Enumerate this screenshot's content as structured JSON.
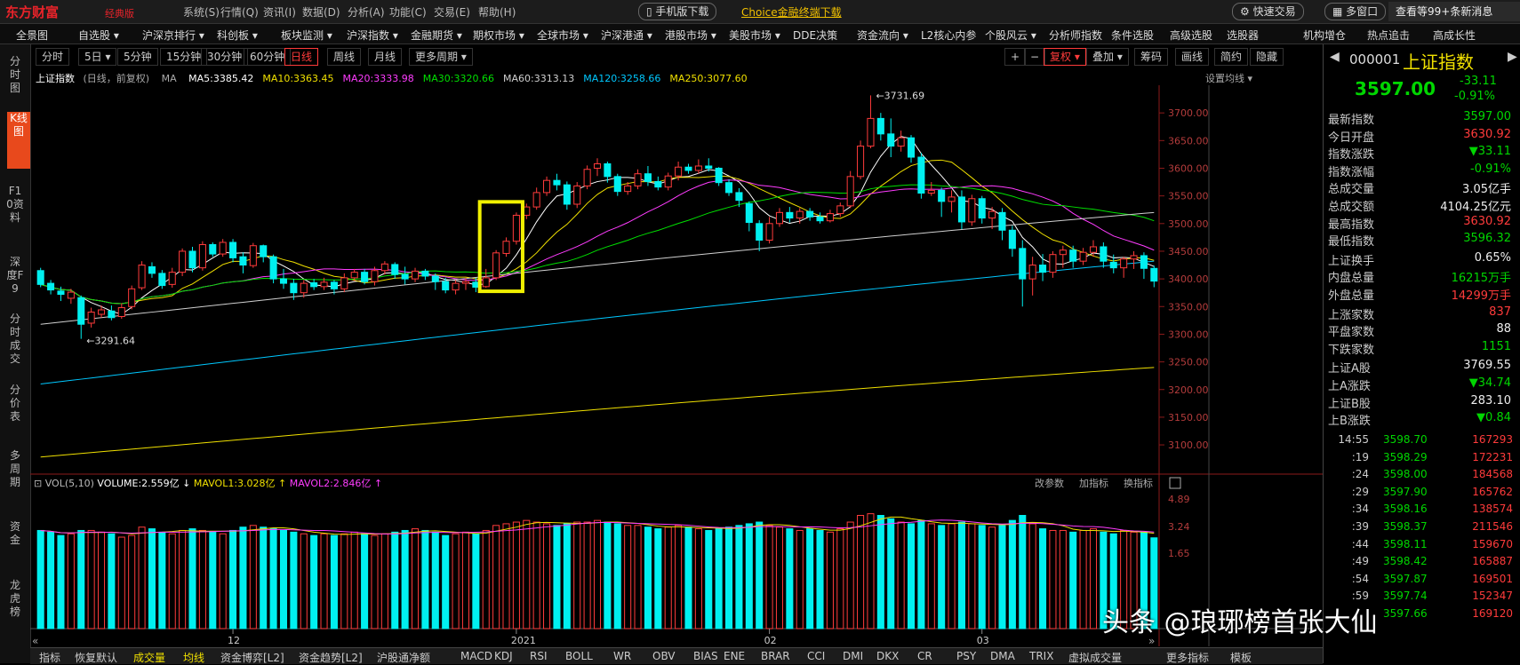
{
  "titlebar": {
    "logo": "东方财富",
    "logo_sub": "经典版",
    "menus": [
      "系统(S)",
      "行情(Q)",
      "资讯(I)",
      "数据(D)",
      "分析(A)",
      "功能(C)",
      "交易(E)",
      "帮助(H)"
    ],
    "mobile_btn": "手机版下载",
    "choice_link": "Choice金融终端下载",
    "fast_trade": "快速交易",
    "multi_window": "多窗口",
    "news": "查看等99+条新消息"
  },
  "navbar": [
    "全景图",
    "自选股 ▾",
    "沪深京排行 ▾",
    "科创板 ▾",
    "板块监测 ▾",
    "沪深指数 ▾",
    "金融期货 ▾",
    "期权市场 ▾",
    "全球市场 ▾",
    "沪深港通 ▾",
    "港股市场 ▾",
    "美股市场 ▾",
    "DDE决策",
    "资金流向 ▾",
    "L2核心内参",
    "个股风云 ▾",
    "分析师指数",
    "条件选股",
    "高级选股",
    "选股器",
    "机构增仓",
    "热点追击",
    "高成长性"
  ],
  "left_tabs": [
    "分时图",
    "K线图",
    "F10资料",
    "深度F9",
    "分时成交",
    "分价表",
    "多周期",
    "资金",
    "龙虎榜"
  ],
  "period_buttons": [
    "分时",
    "5日 ▾",
    "5分钟",
    "15分钟",
    "30分钟",
    "60分钟",
    "日线",
    "周线",
    "月线",
    "更多周期 ▾"
  ],
  "right_tools": [
    "+",
    "−",
    "复权 ▾",
    "叠加 ▾",
    "筹码",
    "画线",
    "简约",
    "隐藏"
  ],
  "ma_line": {
    "title": "上证指数",
    "mode": "(日线，前复权)",
    "tag": "MA",
    "items": [
      {
        "text": "MA5:3385.42",
        "color": "#ffffff"
      },
      {
        "text": "MA10:3363.45",
        "color": "#f0e000"
      },
      {
        "text": "MA20:3333.98",
        "color": "#ff3cff"
      },
      {
        "text": "MA30:3320.66",
        "color": "#00e000"
      },
      {
        "text": "MA60:3313.13",
        "color": "#d0d0d0"
      },
      {
        "text": "MA120:3258.66",
        "color": "#00c8ff"
      },
      {
        "text": "MA250:3077.60",
        "color": "#f0e000"
      }
    ],
    "settings": "设置均线 ▾"
  },
  "price_axis": [
    "3700.00",
    "3650.00",
    "3600.00",
    "3550.00",
    "3500.00",
    "3450.00",
    "3400.00",
    "3350.00",
    "3300.00",
    "3250.00",
    "3200.00",
    "3150.00",
    "3100.00"
  ],
  "high_label": "3731.69",
  "low_label": "3291.64",
  "vol_line": {
    "head": "VOL(5,10)",
    "vol": "VOLUME:2.559亿",
    "mavol1": "MAVOL1:3.028亿",
    "mavol2": "MAVOL2:2.846亿",
    "tools": [
      "改参数",
      "加指标",
      "换指标"
    ]
  },
  "vol_axis": [
    "4.89",
    "3.24",
    "1.65"
  ],
  "date_axis": [
    "12",
    "2021",
    "02",
    "03"
  ],
  "bottom_tabs": [
    "指标",
    "恢复默认",
    "成交量",
    "均线",
    "资金博弈[L2]",
    "资金趋势[L2]",
    "沪股通净额",
    "MACD",
    "KDJ",
    "RSI",
    "BOLL",
    "WR",
    "OBV",
    "BIAS",
    "ENE",
    "BRAR",
    "CCI",
    "DMI",
    "DKX",
    "CR",
    "PSY",
    "DMA",
    "TRIX",
    "虚拟成交量",
    "更多指标",
    "模板"
  ],
  "quote": {
    "code": "000001",
    "name": "上证指数",
    "price": "3597.00",
    "change": "-33.11",
    "change_pct": "-0.91%",
    "rows": [
      {
        "label": "最新指数",
        "value": "3597.00",
        "cls": "green"
      },
      {
        "label": "今日开盘",
        "value": "3630.92",
        "cls": "red"
      },
      {
        "label": "指数涨跌",
        "value": "▼33.11",
        "cls": "green"
      },
      {
        "label": "指数涨幅",
        "value": "-0.91%",
        "cls": "green"
      },
      {
        "label": "总成交量",
        "value": "3.05亿手",
        "cls": "white"
      },
      {
        "label": "总成交额",
        "value": "4104.25亿元",
        "cls": "white"
      },
      {
        "label": "最高指数",
        "value": "3630.92",
        "cls": "red"
      },
      {
        "label": "最低指数",
        "value": "3596.32",
        "cls": "green"
      },
      {
        "label": "上证换手",
        "value": "0.65%",
        "cls": "white"
      },
      {
        "label": "内盘总量",
        "value": "16215万手",
        "cls": "green"
      },
      {
        "label": "外盘总量",
        "value": "14299万手",
        "cls": "red"
      },
      {
        "label": "上涨家数",
        "value": "837",
        "cls": "red"
      },
      {
        "label": "平盘家数",
        "value": "88",
        "cls": "white"
      },
      {
        "label": "下跌家数",
        "value": "1151",
        "cls": "green"
      },
      {
        "label": "上证A股",
        "value": "3769.55",
        "cls": "white"
      },
      {
        "label": "上A涨跌",
        "value": "▼34.74",
        "cls": "green"
      },
      {
        "label": "上证B股",
        "value": "283.10",
        "cls": "white"
      },
      {
        "label": "上B涨跌",
        "value": "▼0.84",
        "cls": "green"
      }
    ],
    "ticks": [
      {
        "t": "14:55",
        "p": "3598.70",
        "v": "167293"
      },
      {
        "t": ":19",
        "p": "3598.29",
        "v": "172231"
      },
      {
        "t": ":24",
        "p": "3598.00",
        "v": "184568"
      },
      {
        "t": ":29",
        "p": "3597.90",
        "v": "165762"
      },
      {
        "t": ":34",
        "p": "3598.16",
        "v": "138574"
      },
      {
        "t": ":39",
        "p": "3598.37",
        "v": "211546"
      },
      {
        "t": ":44",
        "p": "3598.11",
        "v": "159670"
      },
      {
        "t": ":49",
        "p": "3598.42",
        "v": "165887"
      },
      {
        "t": ":54",
        "p": "3597.87",
        "v": "169501"
      },
      {
        "t": ":59",
        "p": "3597.74",
        "v": "152347"
      },
      {
        "t": "",
        "p": "3597.66",
        "v": "169120"
      }
    ]
  },
  "watermark": "头条 @琅琊榜首张大仙",
  "chart_data": {
    "type": "candlestick",
    "y_range": [
      3060,
      3750
    ],
    "candles": [
      [
        3415,
        3390,
        3420,
        3385
      ],
      [
        3392,
        3380,
        3398,
        3372
      ],
      [
        3378,
        3372,
        3386,
        3360
      ],
      [
        3365,
        3376,
        3382,
        3355
      ],
      [
        3366,
        3318,
        3370,
        3291.64
      ],
      [
        3320,
        3340,
        3348,
        3312
      ],
      [
        3336,
        3344,
        3352,
        3330
      ],
      [
        3342,
        3330,
        3352,
        3325
      ],
      [
        3332,
        3348,
        3356,
        3328
      ],
      [
        3350,
        3382,
        3388,
        3345
      ],
      [
        3384,
        3425,
        3432,
        3380
      ],
      [
        3422,
        3410,
        3430,
        3402
      ],
      [
        3410,
        3388,
        3416,
        3382
      ],
      [
        3390,
        3412,
        3420,
        3384
      ],
      [
        3412,
        3450,
        3455,
        3405
      ],
      [
        3450,
        3420,
        3458,
        3412
      ],
      [
        3420,
        3462,
        3468,
        3415
      ],
      [
        3462,
        3445,
        3466,
        3440
      ],
      [
        3445,
        3466,
        3472,
        3440
      ],
      [
        3466,
        3438,
        3472,
        3430
      ],
      [
        3440,
        3425,
        3448,
        3410
      ],
      [
        3424,
        3460,
        3465,
        3420
      ],
      [
        3460,
        3440,
        3462,
        3430
      ],
      [
        3440,
        3400,
        3444,
        3392
      ],
      [
        3400,
        3392,
        3418,
        3382
      ],
      [
        3392,
        3375,
        3400,
        3362
      ],
      [
        3375,
        3392,
        3398,
        3366
      ],
      [
        3393,
        3386,
        3400,
        3380
      ],
      [
        3386,
        3394,
        3402,
        3380
      ],
      [
        3394,
        3382,
        3398,
        3372
      ],
      [
        3382,
        3402,
        3410,
        3376
      ],
      [
        3402,
        3412,
        3418,
        3396
      ],
      [
        3412,
        3395,
        3418,
        3390
      ],
      [
        3395,
        3415,
        3422,
        3388
      ],
      [
        3415,
        3427,
        3432,
        3408
      ],
      [
        3426,
        3408,
        3430,
        3400
      ],
      [
        3408,
        3400,
        3422,
        3390
      ],
      [
        3400,
        3414,
        3420,
        3394
      ],
      [
        3414,
        3405,
        3418,
        3398
      ],
      [
        3405,
        3395,
        3410,
        3380
      ],
      [
        3395,
        3380,
        3402,
        3374
      ],
      [
        3380,
        3392,
        3398,
        3372
      ],
      [
        3392,
        3395,
        3402,
        3380
      ],
      [
        3394,
        3385,
        3402,
        3376
      ],
      [
        3386,
        3402,
        3418,
        3384
      ],
      [
        3402,
        3447,
        3452,
        3398
      ],
      [
        3446,
        3468,
        3475,
        3440
      ],
      [
        3468,
        3515,
        3520,
        3462
      ],
      [
        3515,
        3530,
        3536,
        3508
      ],
      [
        3530,
        3556,
        3565,
        3525
      ],
      [
        3556,
        3578,
        3585,
        3550
      ],
      [
        3578,
        3570,
        3590,
        3560
      ],
      [
        3570,
        3535,
        3576,
        3525
      ],
      [
        3535,
        3568,
        3575,
        3528
      ],
      [
        3568,
        3598,
        3605,
        3562
      ],
      [
        3600,
        3608,
        3618,
        3586
      ],
      [
        3608,
        3585,
        3612,
        3574
      ],
      [
        3585,
        3558,
        3590,
        3550
      ],
      [
        3558,
        3568,
        3575,
        3552
      ],
      [
        3568,
        3590,
        3598,
        3562
      ],
      [
        3590,
        3576,
        3604,
        3568
      ],
      [
        3576,
        3566,
        3585,
        3560
      ],
      [
        3566,
        3586,
        3592,
        3560
      ],
      [
        3586,
        3602,
        3612,
        3578
      ],
      [
        3602,
        3596,
        3608,
        3590
      ],
      [
        3596,
        3604,
        3616,
        3590
      ],
      [
        3604,
        3600,
        3618,
        3594
      ],
      [
        3600,
        3574,
        3602,
        3568
      ],
      [
        3574,
        3556,
        3580,
        3550
      ],
      [
        3556,
        3542,
        3564,
        3530
      ],
      [
        3536,
        3502,
        3540,
        3486
      ],
      [
        3500,
        3470,
        3506,
        3450
      ],
      [
        3470,
        3500,
        3512,
        3464
      ],
      [
        3500,
        3520,
        3528,
        3494
      ],
      [
        3520,
        3510,
        3530,
        3502
      ],
      [
        3510,
        3522,
        3528,
        3500
      ],
      [
        3522,
        3512,
        3528,
        3505
      ],
      [
        3512,
        3505,
        3520,
        3500
      ],
      [
        3505,
        3518,
        3525,
        3502
      ],
      [
        3518,
        3532,
        3538,
        3512
      ],
      [
        3532,
        3585,
        3595,
        3528
      ],
      [
        3585,
        3640,
        3650,
        3580
      ],
      [
        3640,
        3690,
        3731.69,
        3636
      ],
      [
        3690,
        3662,
        3700,
        3650
      ],
      [
        3662,
        3640,
        3690,
        3620
      ],
      [
        3640,
        3655,
        3668,
        3630
      ],
      [
        3655,
        3620,
        3660,
        3610
      ],
      [
        3620,
        3555,
        3628,
        3545
      ],
      [
        3555,
        3560,
        3575,
        3550
      ],
      [
        3560,
        3540,
        3565,
        3512
      ],
      [
        3540,
        3548,
        3560,
        3520
      ],
      [
        3548,
        3503,
        3560,
        3490
      ],
      [
        3503,
        3545,
        3552,
        3496
      ],
      [
        3545,
        3510,
        3550,
        3500
      ],
      [
        3510,
        3522,
        3530,
        3490
      ],
      [
        3520,
        3488,
        3528,
        3470
      ],
      [
        3488,
        3455,
        3496,
        3440
      ],
      [
        3455,
        3400,
        3470,
        3350
      ],
      [
        3400,
        3425,
        3440,
        3370
      ],
      [
        3425,
        3412,
        3445,
        3396
      ],
      [
        3412,
        3444,
        3450,
        3402
      ],
      [
        3444,
        3452,
        3460,
        3420
      ],
      [
        3452,
        3432,
        3460,
        3420
      ],
      [
        3432,
        3448,
        3456,
        3425
      ],
      [
        3448,
        3458,
        3470,
        3440
      ],
      [
        3458,
        3432,
        3466,
        3420
      ],
      [
        3430,
        3420,
        3444,
        3410
      ],
      [
        3420,
        3436,
        3440,
        3402
      ],
      [
        3436,
        3442,
        3450,
        3418
      ],
      [
        3442,
        3419,
        3448,
        3400
      ],
      [
        3419,
        3396,
        3424,
        3385
      ]
    ],
    "volume": [
      3.0,
      2.9,
      2.7,
      2.8,
      3.0,
      3.0,
      2.9,
      2.8,
      2.6,
      2.7,
      3.2,
      3.1,
      2.9,
      2.8,
      3.0,
      3.1,
      3.0,
      2.9,
      2.8,
      3.0,
      3.2,
      3.3,
      3.2,
      3.1,
      3.0,
      2.9,
      2.8,
      2.7,
      2.8,
      2.7,
      2.8,
      2.9,
      2.8,
      2.7,
      2.8,
      2.9,
      3.0,
      3.1,
      3.0,
      2.9,
      2.7,
      2.8,
      2.9,
      2.8,
      3.0,
      3.3,
      3.4,
      3.5,
      3.6,
      3.5,
      3.4,
      3.3,
      3.4,
      3.5,
      3.5,
      3.6,
      3.5,
      3.4,
      3.3,
      3.3,
      3.2,
      3.1,
      3.2,
      3.3,
      3.2,
      3.1,
      3.0,
      3.1,
      3.2,
      3.3,
      3.4,
      3.5,
      3.3,
      3.2,
      3.1,
      3.0,
      3.1,
      3.0,
      2.9,
      3.1,
      3.5,
      3.9,
      4.0,
      3.9,
      3.7,
      3.5,
      3.4,
      3.6,
      3.4,
      3.3,
      3.4,
      3.5,
      3.4,
      3.3,
      3.2,
      3.3,
      3.6,
      3.9,
      3.4,
      3.1,
      3.0,
      3.0,
      2.9,
      3.0,
      3.1,
      2.9,
      2.8,
      3.0,
      2.9,
      2.9,
      2.56
    ],
    "vol_range": [
      0,
      5.2
    ],
    "ma_lines": [
      {
        "name": "MA5",
        "color": "#ffffff",
        "period": 5
      },
      {
        "name": "MA10",
        "color": "#f0e000",
        "period": 10
      },
      {
        "name": "MA20",
        "color": "#ff3cff",
        "period": 20
      },
      {
        "name": "MA30",
        "color": "#00e000",
        "period": 30
      },
      {
        "name": "MA60",
        "color": "#d0d0d0",
        "start": 3318,
        "end": 3520
      },
      {
        "name": "MA120",
        "color": "#00c8ff",
        "start": 3210,
        "end": 3432
      },
      {
        "name": "MA250",
        "color": "#f0e000",
        "start": 3078,
        "end": 3240
      }
    ],
    "highlight_candles": [
      44,
      47
    ]
  }
}
